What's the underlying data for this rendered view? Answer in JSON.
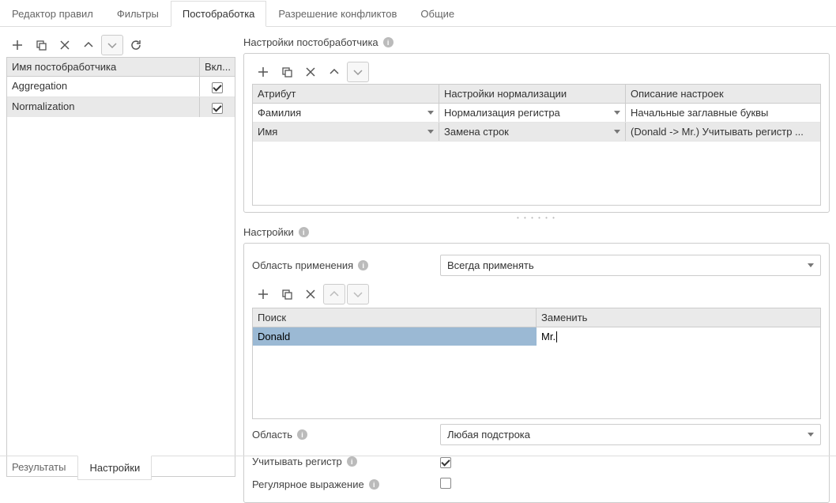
{
  "topTabs": {
    "t0": "Редактор правил",
    "t1": "Фильтры",
    "t2": "Постобработка",
    "t3": "Разрешение конфликтов",
    "t4": "Общие"
  },
  "left": {
    "hdr_name": "Имя постобработчика",
    "hdr_enabled": "Вкл...",
    "rows": {
      "r0": "Aggregation",
      "r1": "Normalization"
    }
  },
  "right": {
    "title": "Настройки постобработчика",
    "attr": {
      "h0": "Атрибут",
      "h1": "Настройки нормализации",
      "h2": "Описание настроек",
      "r0c0": "Фамилия",
      "r0c1": "Нормализация регистра",
      "r0c2": "Начальные заглавные буквы",
      "r1c0": "Имя",
      "r1c1": "Замена строк",
      "r1c2": "(Donald -> Mr.) Учитывать регистр ..."
    },
    "settings_title": "Настройки",
    "scope_label": "Область применения",
    "scope_value": "Всегда применять",
    "sr": {
      "h0": "Поиск",
      "h1": "Заменить",
      "r0c0": "Donald",
      "r0c1": "Mr."
    },
    "area_label": "Область",
    "area_value": "Любая подстрока",
    "case_label": "Учитывать регистр",
    "regex_label": "Регулярное выражение"
  },
  "bottomTabs": {
    "b0": "Результаты",
    "b1": "Настройки"
  }
}
